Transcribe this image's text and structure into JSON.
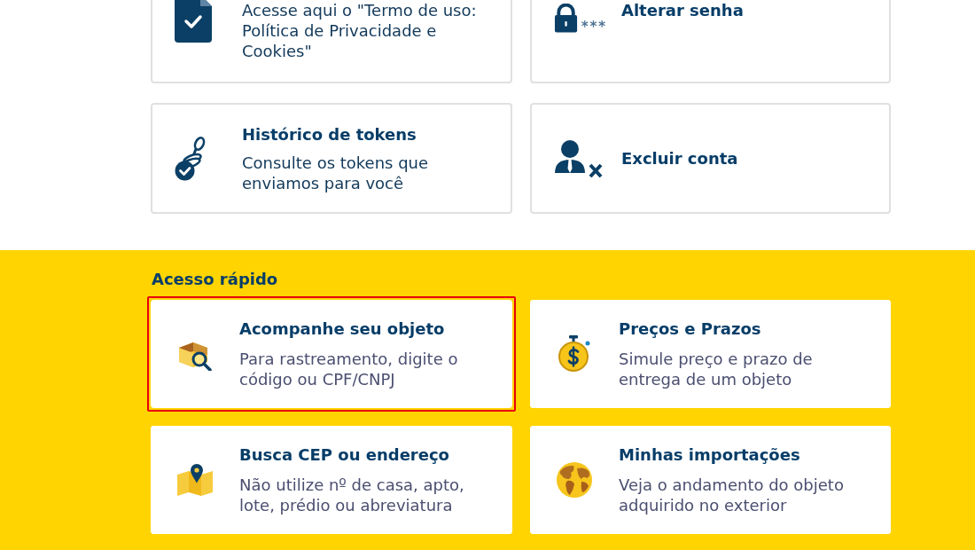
{
  "account_options": [
    {
      "kind": "terms",
      "description": "Acesse aqui o \"Termo de uso: Política de Privacidade e Cookies\""
    },
    {
      "kind": "password",
      "title": "Alterar senha"
    },
    {
      "kind": "tokens",
      "title": "Histórico de tokens",
      "description": "Consulte os tokens que enviamos para você"
    },
    {
      "kind": "deletion",
      "title": "Excluir conta"
    }
  ],
  "quick_access": {
    "heading": "Acesso rápido",
    "items": [
      {
        "kind": "tracking",
        "title": "Acompanhe seu objeto",
        "description": "Para rastreamento, digite o código ou CPF/CNPJ",
        "highlighted": true
      },
      {
        "kind": "pricing",
        "title": "Preços e Prazos",
        "description": "Simule preço e prazo de entrega de um objeto",
        "highlighted": false
      },
      {
        "kind": "address",
        "title": "Busca CEP ou endereço",
        "description": "Não utilize nº de casa, apto, lote, prédio ou abreviatura",
        "highlighted": false
      },
      {
        "kind": "imports",
        "title": "Minhas importações",
        "description": "Veja o andamento do objeto adquirido no exterior",
        "highlighted": false
      }
    ]
  }
}
